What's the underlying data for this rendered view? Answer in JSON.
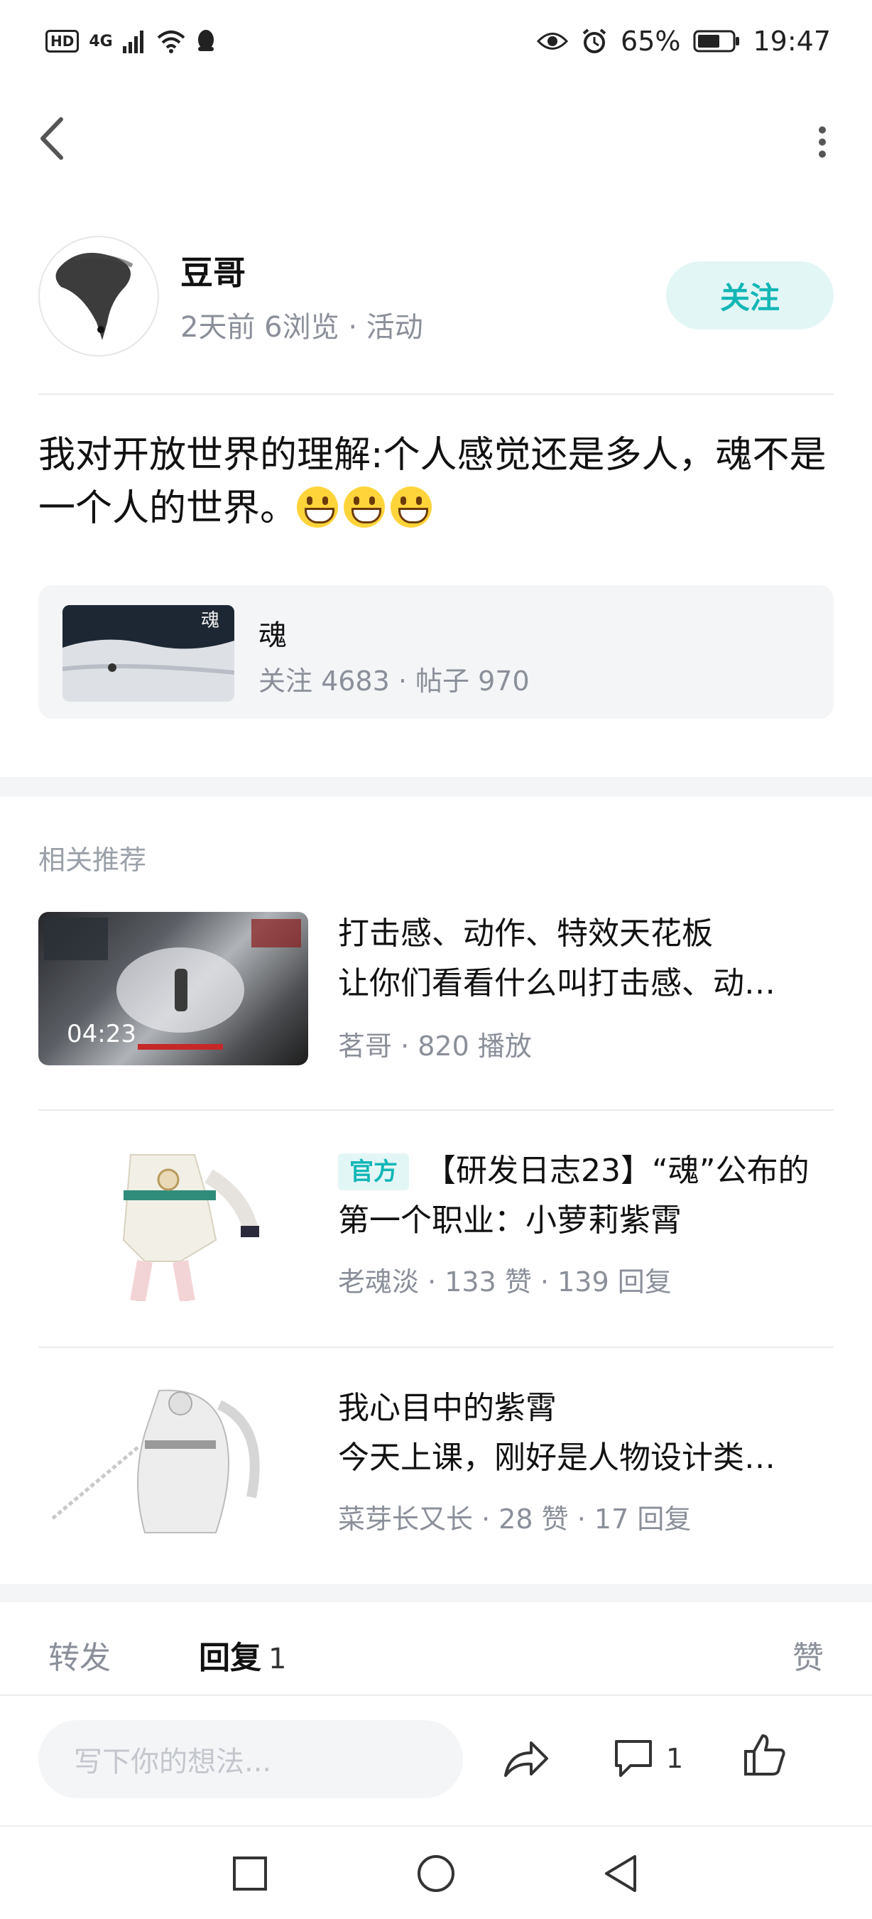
{
  "status_bar": {
    "hd": "HD",
    "network": "4G",
    "battery_percent": "65%",
    "time": "19:47"
  },
  "author": {
    "name": "豆哥",
    "meta": "2天前  6浏览  ·  活动",
    "follow_label": "关注"
  },
  "post": {
    "text": "我对开放世界的理解:个人感觉还是多人，魂不是一个人的世界。"
  },
  "topic": {
    "name": "魂",
    "stats": "关注 4683  ·  帖子 970"
  },
  "recommend": {
    "title": "相关推荐",
    "items": [
      {
        "title": "打击感、动作、特效天花板",
        "subtitle": "让你们看看什么叫打击感、动…",
        "meta": "茗哥  ·  820 播放",
        "duration": "04:23"
      },
      {
        "tag": "官方",
        "title": "【研发日志23】“魂”公布的",
        "subtitle": "第一个职业：小萝莉紫霄",
        "meta": "老魂淡  ·  133 赞  ·  139 回复"
      },
      {
        "title": "我心目中的紫霄",
        "subtitle": "今天上课，刚好是人物设计类…",
        "meta": "菜芽长又长  ·  28 赞  ·  17 回复"
      }
    ]
  },
  "tabs": {
    "forward": "转发",
    "reply": "回复",
    "reply_count": "1",
    "like": "赞"
  },
  "bottom": {
    "input_placeholder": "写下你的想法...",
    "comment_count": "1"
  },
  "colors": {
    "accent": "#13b6b6",
    "accent_bg": "#e3f6f6",
    "muted": "#8a8f99",
    "band": "#f4f5f7"
  }
}
